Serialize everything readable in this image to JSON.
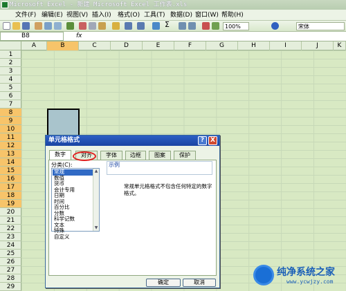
{
  "window": {
    "title": "Microsoft Excel - 新建 Microsoft Excel 工作表.xls"
  },
  "menu": {
    "items": [
      "文件(F)",
      "编辑(E)",
      "视图(V)",
      "插入(I)",
      "格式(O)",
      "工具(T)",
      "数据(D)",
      "窗口(W)",
      "帮助(H)"
    ]
  },
  "toolbar": {
    "zoom": "100%",
    "font": "宋体"
  },
  "formula": {
    "namebox": "B8",
    "fx": "fx"
  },
  "sheet": {
    "columns": [
      "A",
      "B",
      "C",
      "D",
      "E",
      "F",
      "G",
      "H",
      "I",
      "J",
      "K"
    ],
    "rows": [
      "1",
      "2",
      "3",
      "4",
      "5",
      "6",
      "7",
      "8",
      "9",
      "10",
      "11",
      "12",
      "13",
      "14",
      "15",
      "16",
      "17",
      "18",
      "19",
      "20",
      "21",
      "22",
      "23",
      "24",
      "25",
      "26",
      "27",
      "28",
      "29"
    ],
    "selected_rows": [
      "8",
      "9",
      "10",
      "11",
      "12",
      "13",
      "14",
      "15",
      "16",
      "17",
      "18",
      "19"
    ]
  },
  "dialog": {
    "title": "单元格格式",
    "help": "?",
    "close": "X",
    "tabs": [
      "数字",
      "对齐",
      "字体",
      "边框",
      "图案",
      "保护"
    ],
    "category_label": "分类(C):",
    "categories": [
      "常规",
      "数值",
      "货币",
      "会计专用",
      "日期",
      "时间",
      "百分比",
      "分数",
      "科学记数",
      "文本",
      "特殊",
      "自定义"
    ],
    "selected_category": "常规",
    "sample_label": "示例",
    "description": "常规单元格格式不包含任何特定的数字格式。",
    "ok": "确定",
    "cancel": "取消"
  },
  "watermark": {
    "name": "纯净系统之家",
    "url": "www.ycwjzy.com"
  },
  "colors": {
    "excel_green": "#d8e9c3",
    "title_blue": "#1a44a3",
    "select": "#316ac5",
    "highlight_red": "#e02020"
  }
}
